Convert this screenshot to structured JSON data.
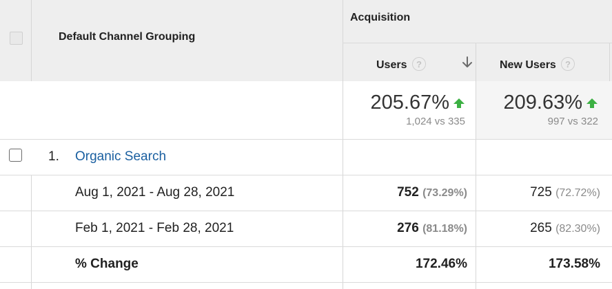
{
  "header": {
    "dimension_label": "Default Channel Grouping",
    "group_label": "Acquisition",
    "columns": [
      {
        "label": "Users",
        "help": "?"
      },
      {
        "label": "New Users",
        "help": "?"
      }
    ]
  },
  "summary": {
    "users": {
      "change": "205.67%",
      "compare": "1,024 vs 335"
    },
    "new_users": {
      "change": "209.63%",
      "compare": "997 vs 322"
    }
  },
  "rows": [
    {
      "index": "1.",
      "name": "Organic Search"
    }
  ],
  "subrows": [
    {
      "label": "Aug 1, 2021 - Aug 28, 2021",
      "users": "752",
      "users_pct": "(73.29%)",
      "new_users": "725",
      "new_users_pct": "(72.72%)"
    },
    {
      "label": "Feb 1, 2021 - Feb 28, 2021",
      "users": "276",
      "users_pct": "(81.18%)",
      "new_users": "265",
      "new_users_pct": "(82.30%)"
    },
    {
      "label": "% Change",
      "users": "172.46%",
      "new_users": "173.58%"
    }
  ],
  "colors": {
    "link": "#1a5fa0",
    "up_arrow": "#3cb043",
    "header_bg": "#eeeeee"
  }
}
